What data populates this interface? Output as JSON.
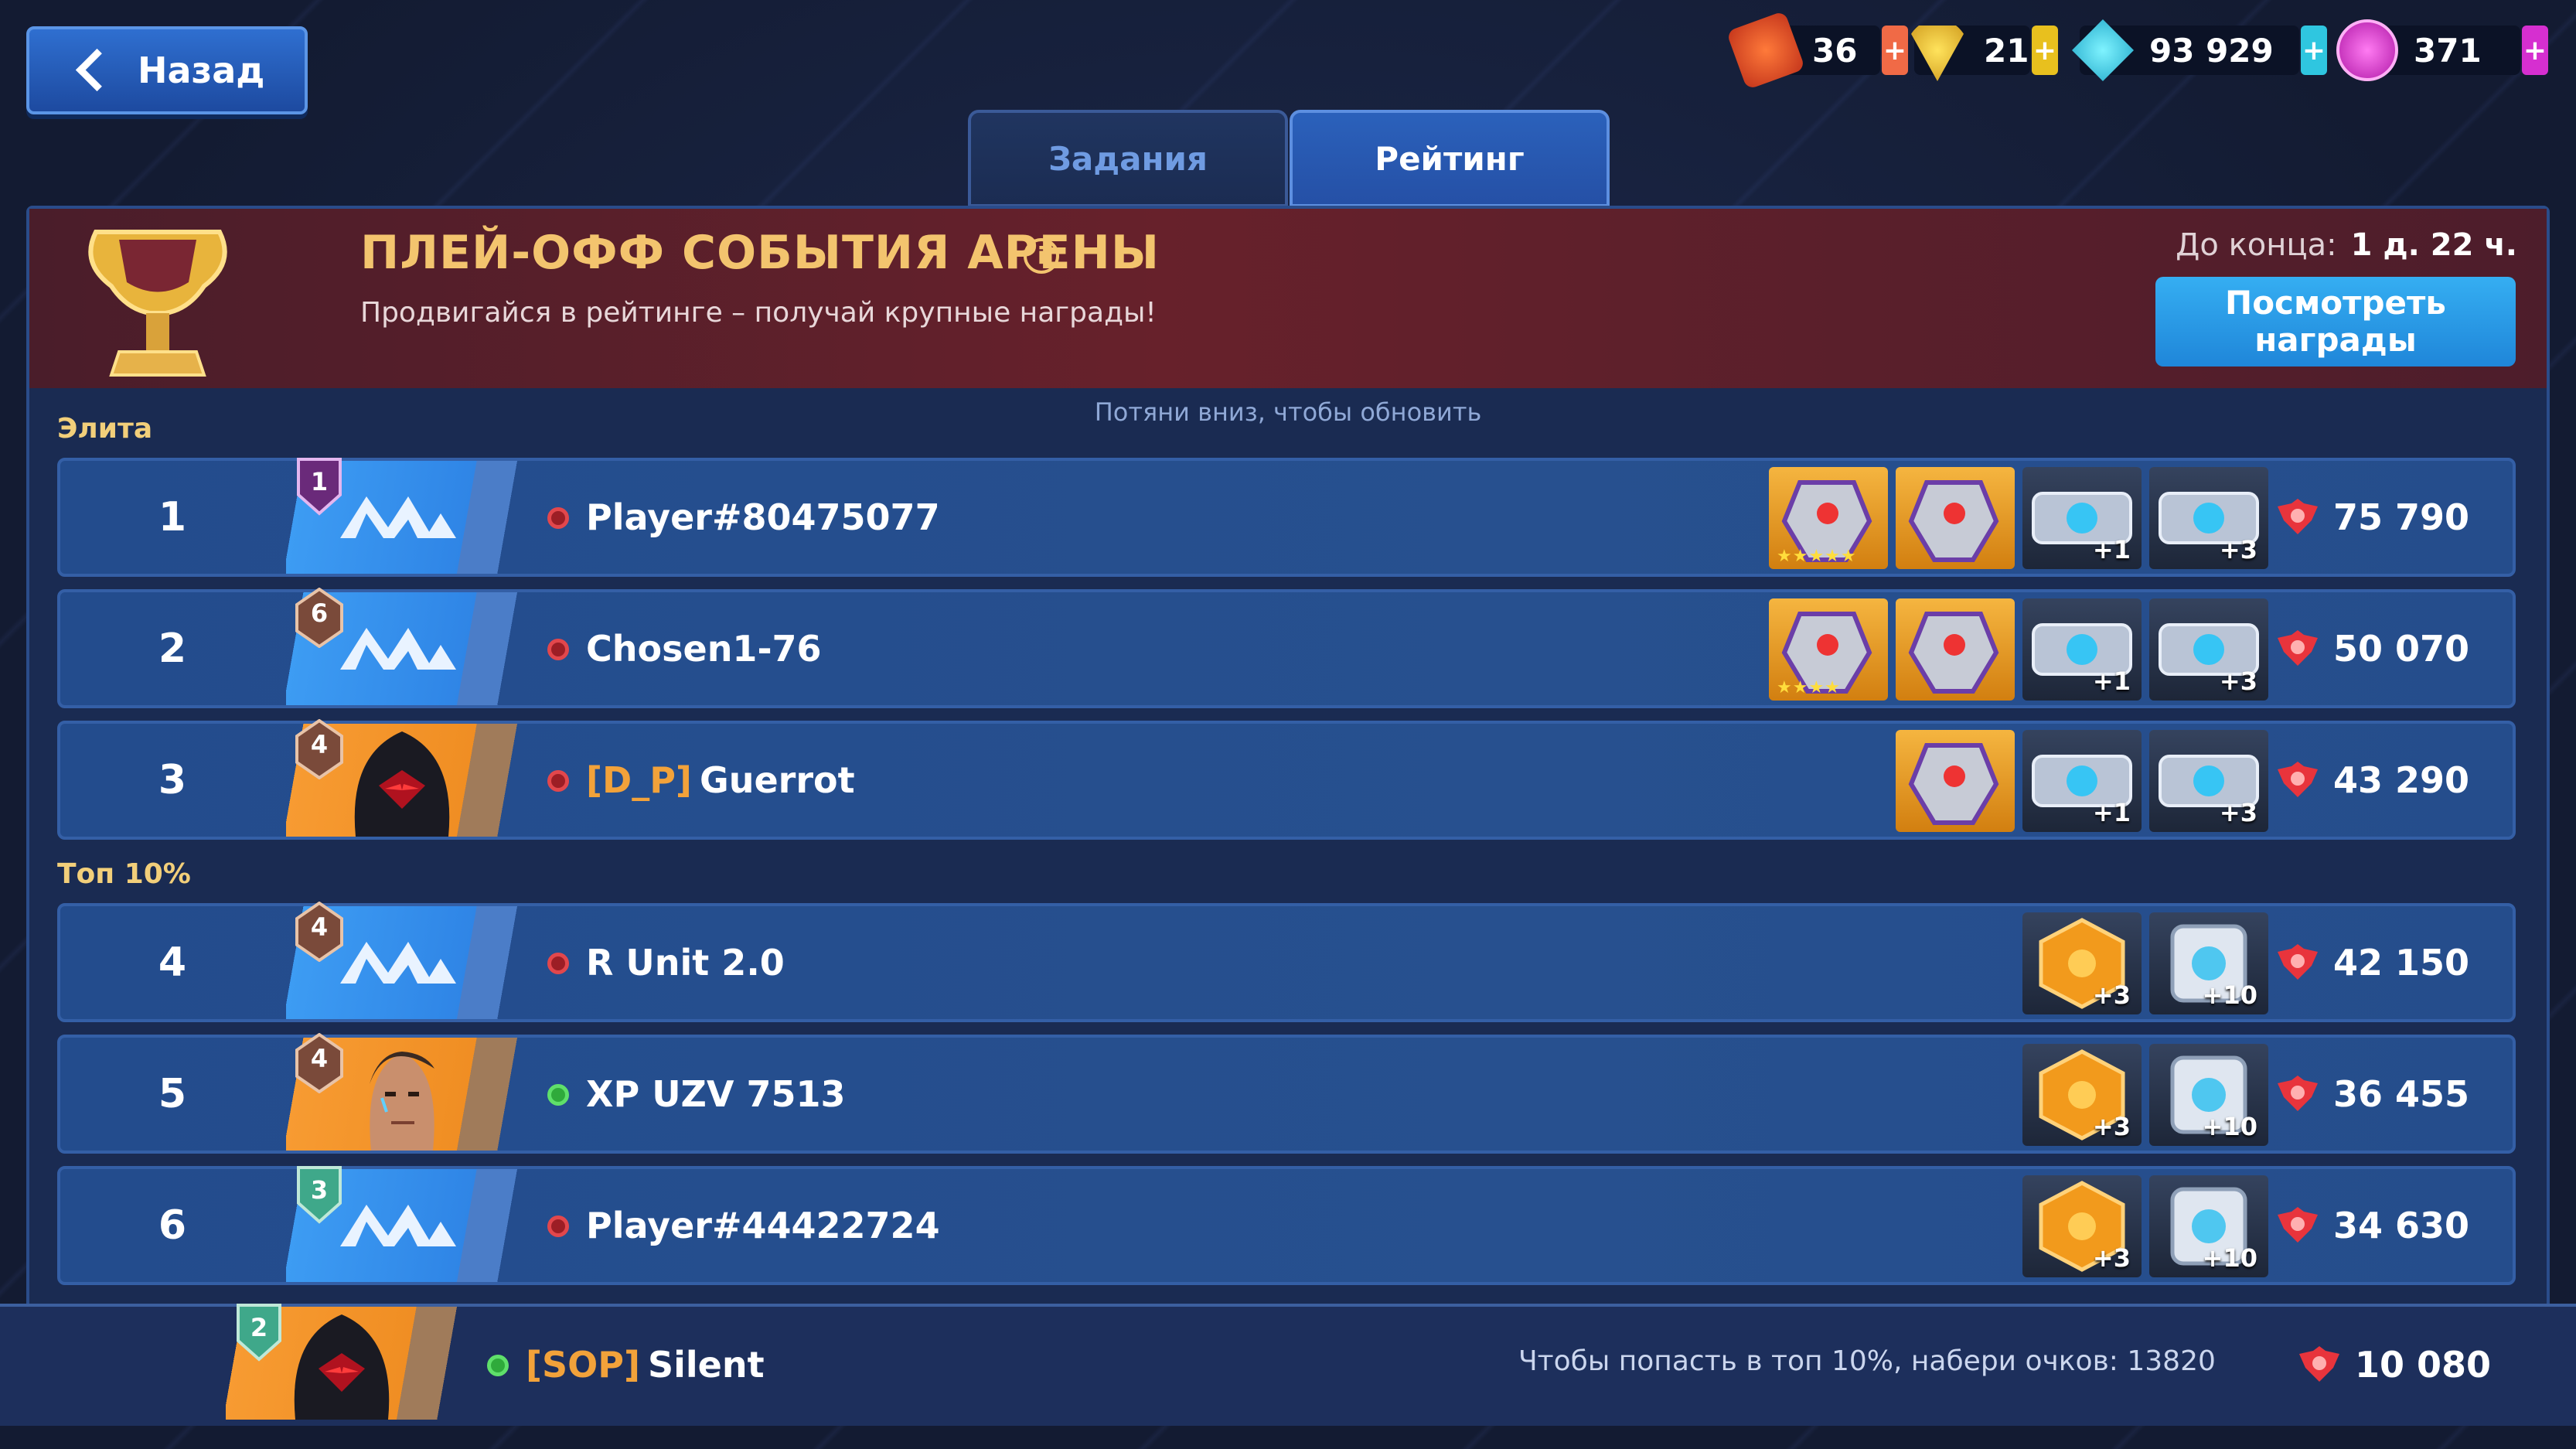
{
  "back": {
    "label": "Назад"
  },
  "currencies": [
    {
      "icon": "arena-ticket-icon",
      "value": "36",
      "color": "#f05a2a"
    },
    {
      "icon": "honor-icon",
      "value": "21",
      "color": "#f2c232"
    },
    {
      "icon": "credits-icon",
      "value": "93 929",
      "color": "#2ad3e6"
    },
    {
      "icon": "premium-icon",
      "value": "371",
      "color": "#e03fd8"
    }
  ],
  "tabs": {
    "tasks": "Задания",
    "rating": "Рейтинг"
  },
  "event": {
    "title": "ПЛЕЙ-ОФФ СОБЫТИЯ АРЕНЫ",
    "subtitle": "Продвигайся в рейтинге – получай крупные награды!",
    "deadline_label": "До конца:",
    "deadline_value": "1 д. 22 ч.",
    "rewards_button_line1": "Посмотреть",
    "rewards_button_line2": "награды"
  },
  "refresh_hint": "Потяни вниз, чтобы обновить",
  "sections": {
    "elite": "Элита",
    "top10": "Топ 10%"
  },
  "rows": [
    {
      "rank": "1",
      "level": "1",
      "clan": "",
      "name": "Player#80475077",
      "online": false,
      "score": "75 790",
      "rewards": [
        {
          "type": "gold",
          "count": "",
          "stars": "★★★★★"
        },
        {
          "type": "gold",
          "count": ""
        },
        {
          "type": "dark",
          "count": "+1"
        },
        {
          "type": "dark",
          "count": "+3"
        }
      ]
    },
    {
      "rank": "2",
      "level": "6",
      "clan": "",
      "name": "Chosen1-76",
      "online": false,
      "score": "50 070",
      "rewards": [
        {
          "type": "gold",
          "count": "",
          "stars": "★★★★"
        },
        {
          "type": "gold",
          "count": ""
        },
        {
          "type": "dark",
          "count": "+1"
        },
        {
          "type": "dark",
          "count": "+3"
        }
      ]
    },
    {
      "rank": "3",
      "level": "4",
      "clan": "[D_P]",
      "name": "Guerrot",
      "online": false,
      "score": "43 290",
      "rewards": [
        {
          "type": "gold",
          "count": ""
        },
        {
          "type": "dark",
          "count": "+1"
        },
        {
          "type": "dark",
          "count": "+3"
        }
      ]
    },
    {
      "rank": "4",
      "level": "4",
      "clan": "",
      "name": "R Unit 2.0",
      "online": false,
      "score": "42 150",
      "rewards": [
        {
          "type": "dark",
          "count": "+3"
        },
        {
          "type": "dark",
          "count": "+10"
        }
      ]
    },
    {
      "rank": "5",
      "level": "4",
      "clan": "",
      "name": "XP UZV 7513",
      "online": true,
      "score": "36 455",
      "rewards": [
        {
          "type": "dark",
          "count": "+3"
        },
        {
          "type": "dark",
          "count": "+10"
        }
      ]
    },
    {
      "rank": "6",
      "level": "3",
      "clan": "",
      "name": "Player#44422724",
      "online": false,
      "score": "34 630",
      "rewards": [
        {
          "type": "dark",
          "count": "+3"
        },
        {
          "type": "dark",
          "count": "+10"
        }
      ]
    }
  ],
  "me": {
    "level": "2",
    "clan": "[SOP]",
    "name": "Silent",
    "online": true,
    "hint": "Чтобы попасть в топ 10%, набери очков: 13820",
    "score": "10 080"
  }
}
